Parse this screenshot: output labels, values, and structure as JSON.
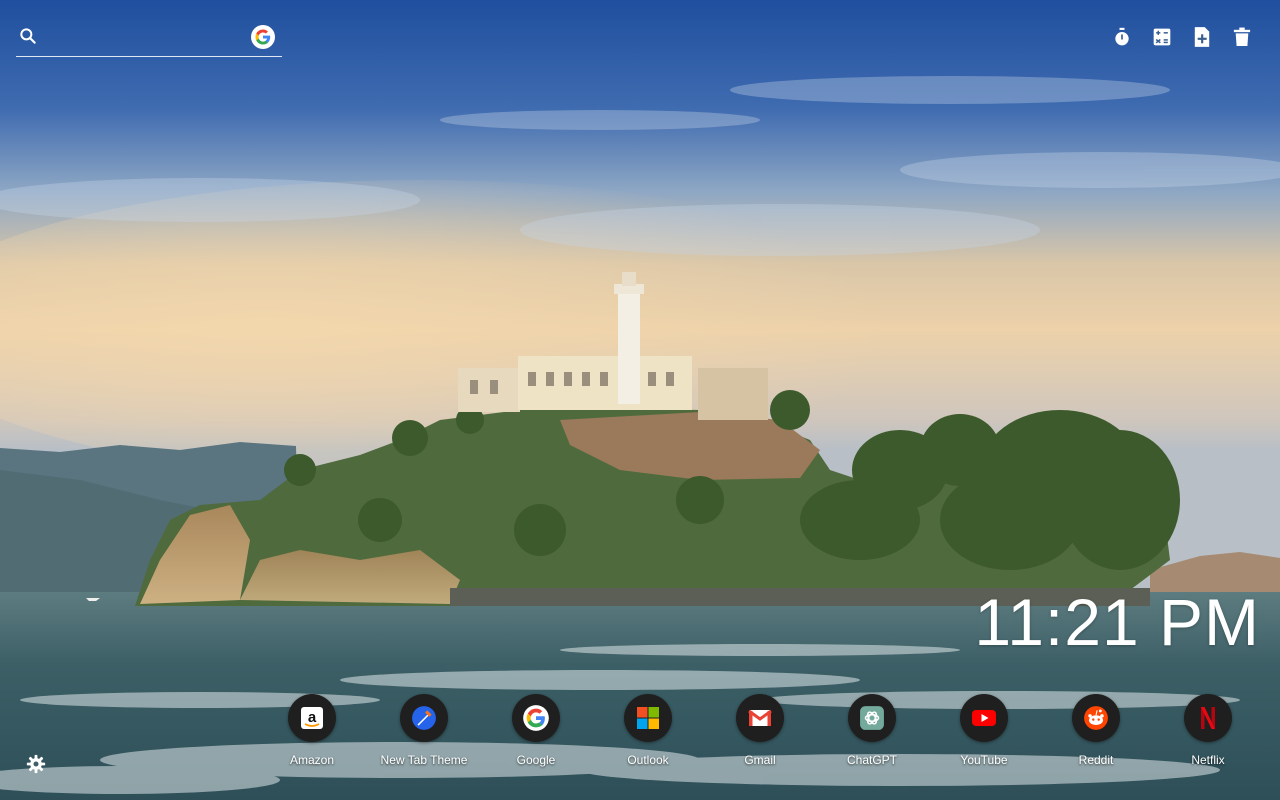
{
  "search": {
    "placeholder": "",
    "engine_icon": "google-icon"
  },
  "toolbar": {
    "icons": [
      "stopwatch-icon",
      "calculator-icon",
      "add-note-icon",
      "trash-icon"
    ]
  },
  "clock": {
    "time": "11:21 PM"
  },
  "shortcuts": [
    {
      "label": "Amazon",
      "icon": "amazon-icon"
    },
    {
      "label": "New Tab Theme",
      "icon": "new-tab-theme-icon"
    },
    {
      "label": "Google",
      "icon": "google-icon"
    },
    {
      "label": "Outlook",
      "icon": "outlook-icon"
    },
    {
      "label": "Gmail",
      "icon": "gmail-icon"
    },
    {
      "label": "ChatGPT",
      "icon": "chatgpt-icon"
    },
    {
      "label": "YouTube",
      "icon": "youtube-icon"
    },
    {
      "label": "Reddit",
      "icon": "reddit-icon"
    },
    {
      "label": "Netflix",
      "icon": "netflix-icon"
    }
  ],
  "settings": {
    "icon": "gear-icon"
  },
  "colors": {
    "sky_top": "#2a57a6",
    "sky_mid": "#6f8fb8",
    "horizon": "#e6c9a2",
    "water": "#3d6168",
    "shortcut_bg": "#1f1f1f",
    "text": "#ffffff"
  }
}
